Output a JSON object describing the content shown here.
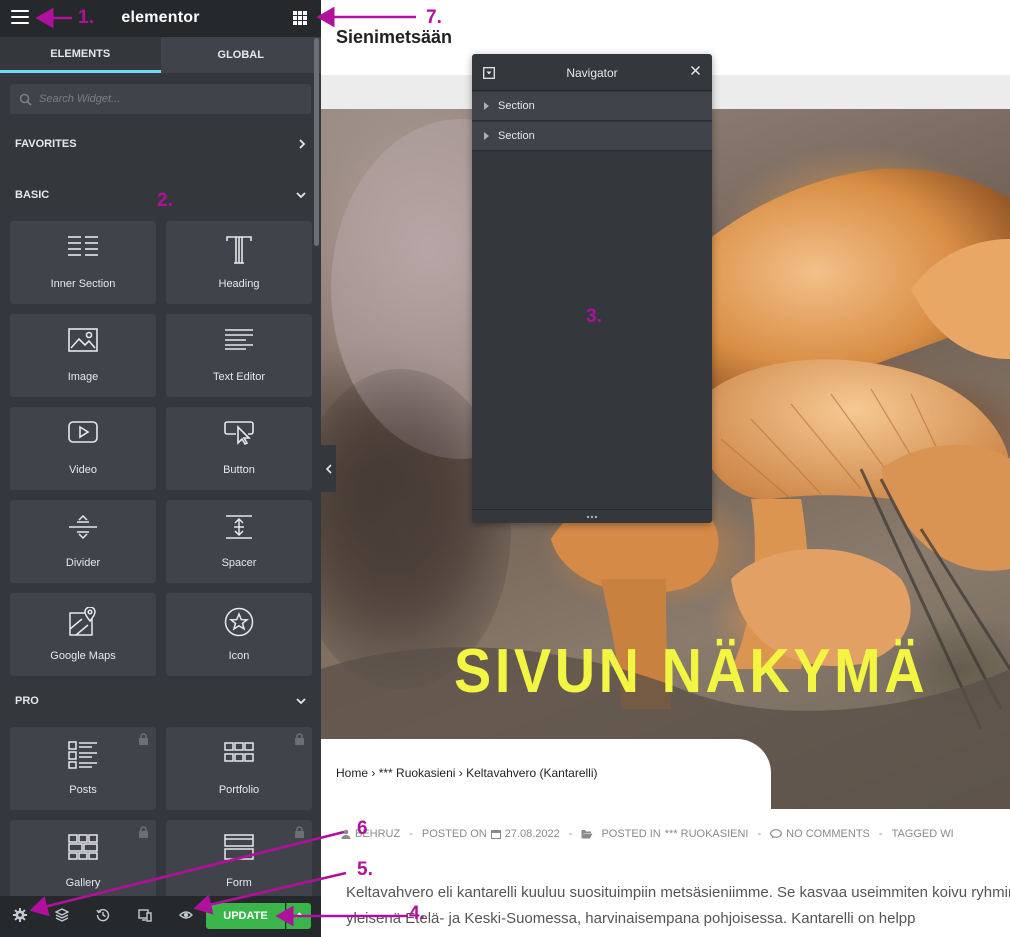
{
  "panel": {
    "logo": "elementor",
    "tabs": {
      "elements": "ELEMENTS",
      "global": "GLOBAL"
    },
    "search_placeholder": "Search Widget...",
    "categories": {
      "favorites": "FAVORITES",
      "basic": "BASIC",
      "pro": "PRO"
    },
    "basic_widgets": [
      {
        "label": "Inner Section",
        "icon": "inner-section-icon"
      },
      {
        "label": "Heading",
        "icon": "heading-icon"
      },
      {
        "label": "Image",
        "icon": "image-icon"
      },
      {
        "label": "Text Editor",
        "icon": "text-editor-icon"
      },
      {
        "label": "Video",
        "icon": "video-icon"
      },
      {
        "label": "Button",
        "icon": "button-icon"
      },
      {
        "label": "Divider",
        "icon": "divider-icon"
      },
      {
        "label": "Spacer",
        "icon": "spacer-icon"
      },
      {
        "label": "Google Maps",
        "icon": "google-maps-icon"
      },
      {
        "label": "Icon",
        "icon": "star-icon"
      }
    ],
    "pro_widgets": [
      {
        "label": "Posts",
        "icon": "posts-icon",
        "locked": true
      },
      {
        "label": "Portfolio",
        "icon": "portfolio-icon",
        "locked": true
      },
      {
        "label": "Gallery",
        "icon": "gallery-icon",
        "locked": true
      },
      {
        "label": "Form",
        "icon": "form-icon",
        "locked": true
      }
    ],
    "footer": {
      "update_label": "UPDATE"
    }
  },
  "navigator": {
    "title": "Navigator",
    "items": [
      {
        "label": "Section"
      },
      {
        "label": "Section"
      }
    ]
  },
  "page": {
    "site_title": "Sienimetsään",
    "hero_title": "SIVUN NÄKYMÄ",
    "breadcrumb": [
      "Home",
      "*** Ruokasieni",
      "Keltavahvero (Kantarelli)"
    ],
    "breadcrumb_separator": "›",
    "meta": {
      "author": "BEHRUZ",
      "posted_on_label": "POSTED ON",
      "date": "27.08.2022",
      "posted_in_label": "POSTED IN",
      "category": "*** RUOKASIENI",
      "comments": "NO COMMENTS",
      "tagged": "TAGGED WI",
      "separator": "-"
    },
    "paragraph": "Keltavahvero eli kantarelli kuuluu suosituimpiin metsäsieniimme. Se kasvaa useimmiten koivu ryhminä, yleisenä Etelä- ja Keski-Suomessa, harvinaisempana pohjoisessa. Kantarelli on helpp"
  },
  "annotations": [
    "1.",
    "2.",
    "3.",
    "4.",
    "5.",
    "6",
    "7."
  ],
  "colors": {
    "panel_bg": "#34383c",
    "panel_header": "#26292c",
    "widget_bg": "#404349",
    "tab_accent": "#71d7f7",
    "update_green": "#39b54a",
    "hero_title": "#f2f542",
    "annotation": "#b0119c"
  }
}
